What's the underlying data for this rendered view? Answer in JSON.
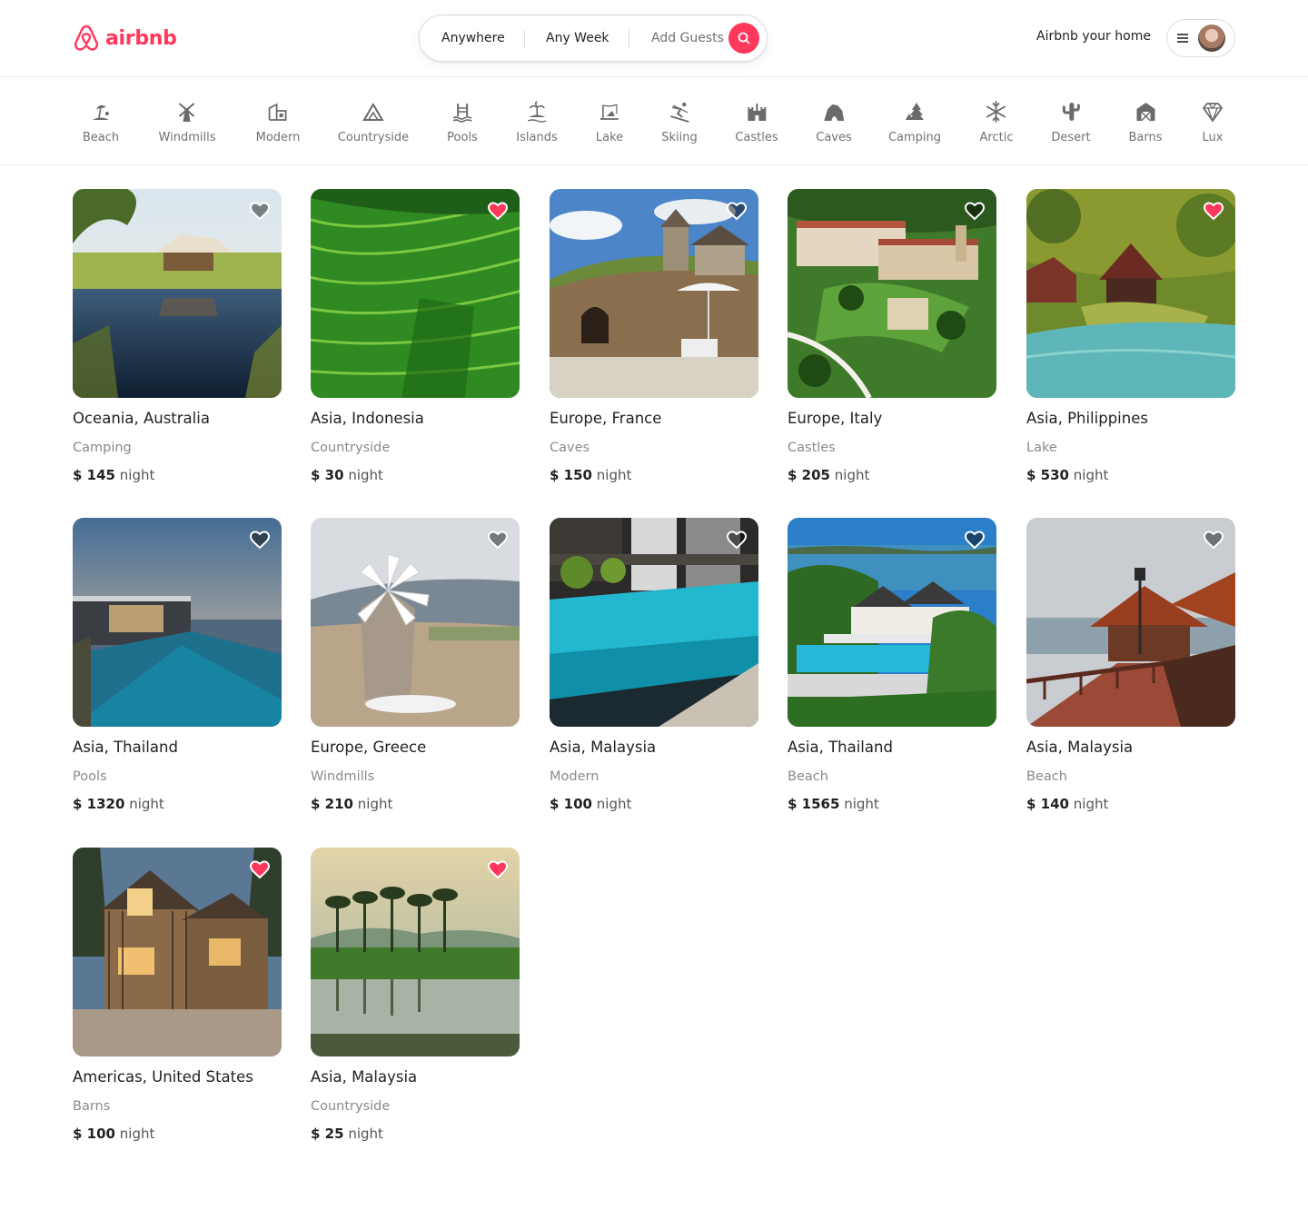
{
  "brand": {
    "name": "airbnb",
    "color": "#ff385c"
  },
  "search": {
    "where": "Anywhere",
    "when": "Any Week",
    "who": "Add Guests"
  },
  "header": {
    "host_link": "Airbnb your home"
  },
  "categories": [
    {
      "label": "Beach",
      "icon": "beach-icon"
    },
    {
      "label": "Windmills",
      "icon": "windmill-icon"
    },
    {
      "label": "Modern",
      "icon": "modern-house-icon"
    },
    {
      "label": "Countryside",
      "icon": "countryside-icon"
    },
    {
      "label": "Pools",
      "icon": "pool-icon"
    },
    {
      "label": "Islands",
      "icon": "island-icon"
    },
    {
      "label": "Lake",
      "icon": "lake-icon"
    },
    {
      "label": "Skiing",
      "icon": "skiing-icon"
    },
    {
      "label": "Castles",
      "icon": "castle-icon"
    },
    {
      "label": "Caves",
      "icon": "cave-icon"
    },
    {
      "label": "Camping",
      "icon": "camping-icon"
    },
    {
      "label": "Arctic",
      "icon": "snowflake-icon"
    },
    {
      "label": "Desert",
      "icon": "cactus-icon"
    },
    {
      "label": "Barns",
      "icon": "barn-icon"
    },
    {
      "label": "Lux",
      "icon": "diamond-icon"
    }
  ],
  "listings": [
    {
      "location": "Oceania, Australia",
      "category": "Camping",
      "currency": "$",
      "price": "145",
      "unit": "night",
      "favorite": false
    },
    {
      "location": "Asia, Indonesia",
      "category": "Countryside",
      "currency": "$",
      "price": "30",
      "unit": "night",
      "favorite": true
    },
    {
      "location": "Europe, France",
      "category": "Caves",
      "currency": "$",
      "price": "150",
      "unit": "night",
      "favorite": false
    },
    {
      "location": "Europe, Italy",
      "category": "Castles",
      "currency": "$",
      "price": "205",
      "unit": "night",
      "favorite": false
    },
    {
      "location": "Asia, Philippines",
      "category": "Lake",
      "currency": "$",
      "price": "530",
      "unit": "night",
      "favorite": true
    },
    {
      "location": "Asia, Thailand",
      "category": "Pools",
      "currency": "$",
      "price": "1320",
      "unit": "night",
      "favorite": false
    },
    {
      "location": "Europe, Greece",
      "category": "Windmills",
      "currency": "$",
      "price": "210",
      "unit": "night",
      "favorite": false
    },
    {
      "location": "Asia, Malaysia",
      "category": "Modern",
      "currency": "$",
      "price": "100",
      "unit": "night",
      "favorite": false
    },
    {
      "location": "Asia, Thailand",
      "category": "Beach",
      "currency": "$",
      "price": "1565",
      "unit": "night",
      "favorite": false
    },
    {
      "location": "Asia, Malaysia",
      "category": "Beach",
      "currency": "$",
      "price": "140",
      "unit": "night",
      "favorite": false
    },
    {
      "location": "Americas, United States",
      "category": "Barns",
      "currency": "$",
      "price": "100",
      "unit": "night",
      "favorite": true
    },
    {
      "location": "Asia, Malaysia",
      "category": "Countryside",
      "currency": "$",
      "price": "25",
      "unit": "night",
      "favorite": true
    }
  ],
  "colors": {
    "heart_active": "#ff385c",
    "heart_inactive": "#ffffff"
  }
}
